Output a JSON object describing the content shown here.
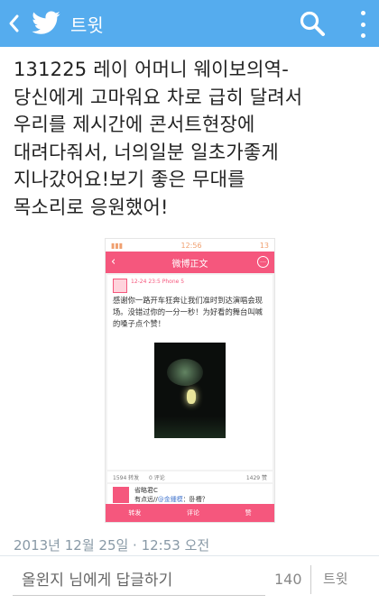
{
  "app_bar": {
    "title": "트윗",
    "back_icon": "chevron-left-icon",
    "logo_icon": "twitter-bird-icon",
    "search_icon": "search-icon",
    "menu_icon": "overflow-menu-icon",
    "color": "#55acee"
  },
  "tweet": {
    "lines": [
      "131225 레이 어머니 웨이보의역-",
      "당신에게 고마워요 차로 급히 달려서",
      "우리를 제시간에 콘서트현장에",
      "대려다줘서, 너의일분 일초가좋게",
      "지나갔어요!보기 좋은 무대를",
      "목소리로 응원했어!"
    ],
    "timestamp": "2013년 12월 25일 · 12:53 오전"
  },
  "embedded_screenshot": {
    "status_time": "12:56",
    "status_right": "13",
    "header_title": "微博正文",
    "post_meta": "12-24 23:5 Phone 5",
    "post_text": "感谢你一路开车狂奔让我们准时到达演唱会现场。没错过你的一分一秒！为好看的舞台叫喊的嗓子点个赞！",
    "stats_repost": "1594 转发",
    "stats_comment": "0 评论",
    "stats_like": "1429 赞",
    "comment_name": "省略君C",
    "comment_prefix": "有点远//",
    "comment_tag": "@金鍾模",
    "comment_suffix": "：卧槽？",
    "tabs": [
      "转发",
      "评论",
      "赞"
    ],
    "accent": "#f5577d"
  },
  "reply": {
    "placeholder": "올윈지 님에게 답글하기",
    "char_count": "140",
    "tweet_label": "트윗"
  }
}
